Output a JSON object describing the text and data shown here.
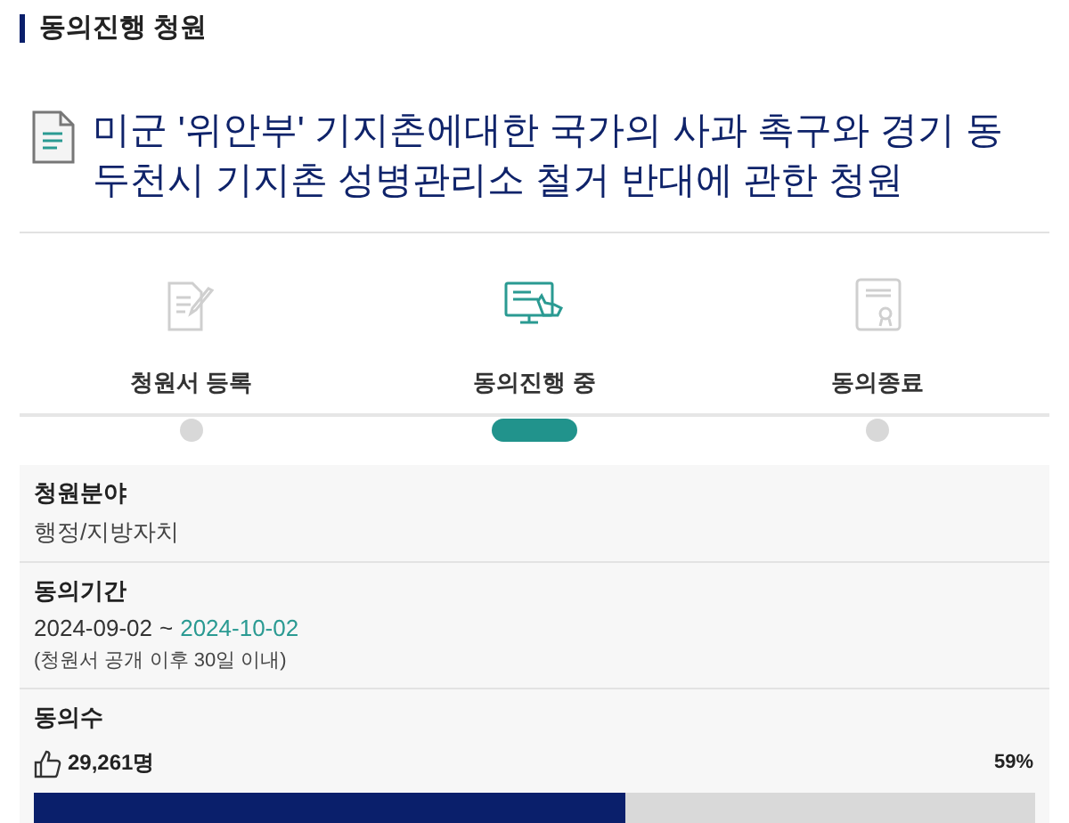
{
  "header": {
    "title": "동의진행 청원"
  },
  "petition": {
    "title": "미군 '위안부' 기지촌에대한 국가의 사과 촉구와 경기 동두천시 기지촌 성병관리소 철거 반대에 관한 청원"
  },
  "steps": [
    {
      "label": "청원서 등록",
      "kind": "write",
      "selected": false
    },
    {
      "label": "동의진행 중",
      "kind": "monitor",
      "selected": true
    },
    {
      "label": "동의종료",
      "kind": "certificate",
      "selected": false
    }
  ],
  "info": {
    "field_label": "청원분야",
    "field_value": "행정/지방자치",
    "period_label": "동의기간",
    "period_start": "2024-09-02",
    "period_sep": "~",
    "period_end": "2024-10-02",
    "period_note": "(청원서 공개 이후 30일 이내)",
    "count_label": "동의수",
    "count": "29,261명",
    "percent": "59%",
    "level": 0.59
  }
}
